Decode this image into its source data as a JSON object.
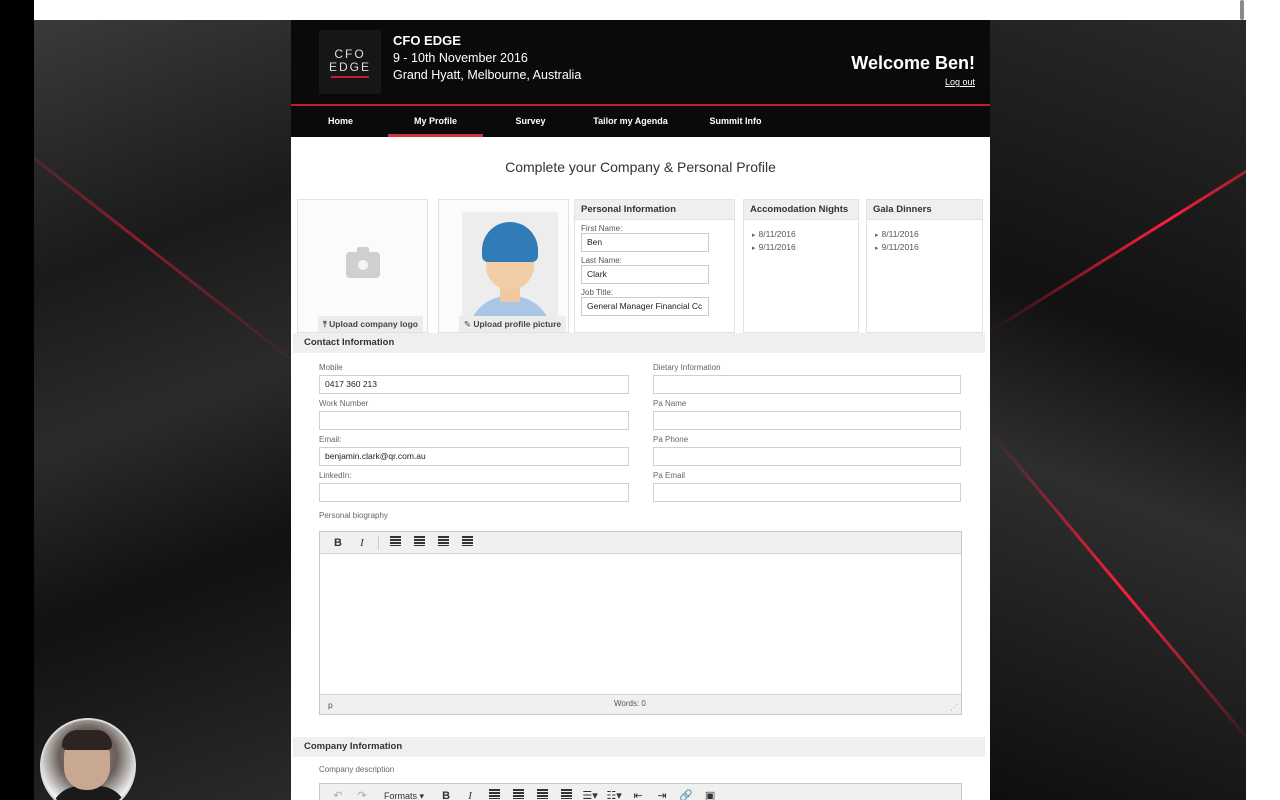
{
  "header": {
    "logo_line1": "CFO",
    "logo_line2": "EDGE",
    "event_name": "CFO EDGE",
    "event_date": "9 - 10th November 2016",
    "event_venue": "Grand Hyatt, Melbourne, Australia",
    "welcome": "Welcome Ben!",
    "logout": "Log out"
  },
  "nav": {
    "items": [
      "Home",
      "My Profile",
      "Survey",
      "Tailor my Agenda",
      "Summit Info"
    ],
    "active": "My Profile"
  },
  "page_title": "Complete your Company & Personal Profile",
  "uploads": {
    "company_logo": "Upload company logo",
    "profile_picture": "Upload profile picture"
  },
  "personal": {
    "title": "Personal Information",
    "first_name_label": "First Name:",
    "first_name": "Ben",
    "last_name_label": "Last Name:",
    "last_name": "Clark",
    "job_title_label": "Job Title:",
    "job_title": "General Manager Financial Cc"
  },
  "accommodation": {
    "title": "Accomodation Nights",
    "dates": [
      "8/11/2016",
      "9/11/2016"
    ]
  },
  "gala": {
    "title": "Gala Dinners",
    "dates": [
      "8/11/2016",
      "9/11/2016"
    ]
  },
  "contact": {
    "title": "Contact Information",
    "mobile_label": "Mobile",
    "mobile": "0417 360 213",
    "work_label": "Work Number",
    "work": "",
    "email_label": "Email:",
    "email": "benjamin.clark@qr.com.au",
    "linkedin_label": "LinkedIn:",
    "linkedin": "",
    "dietary_label": "Dietary Information",
    "dietary": "",
    "pa_name_label": "Pa Name",
    "pa_name": "",
    "pa_phone_label": "Pa Phone",
    "pa_phone": "",
    "pa_email_label": "Pa Email",
    "pa_email": "",
    "bio_label": "Personal biography",
    "editor_path": "p",
    "word_count": "Words: 0"
  },
  "company": {
    "title": "Company Information",
    "description_label": "Company description",
    "formats_label": "Formats"
  },
  "toolbar": {
    "bold": "B",
    "italic": "I"
  }
}
